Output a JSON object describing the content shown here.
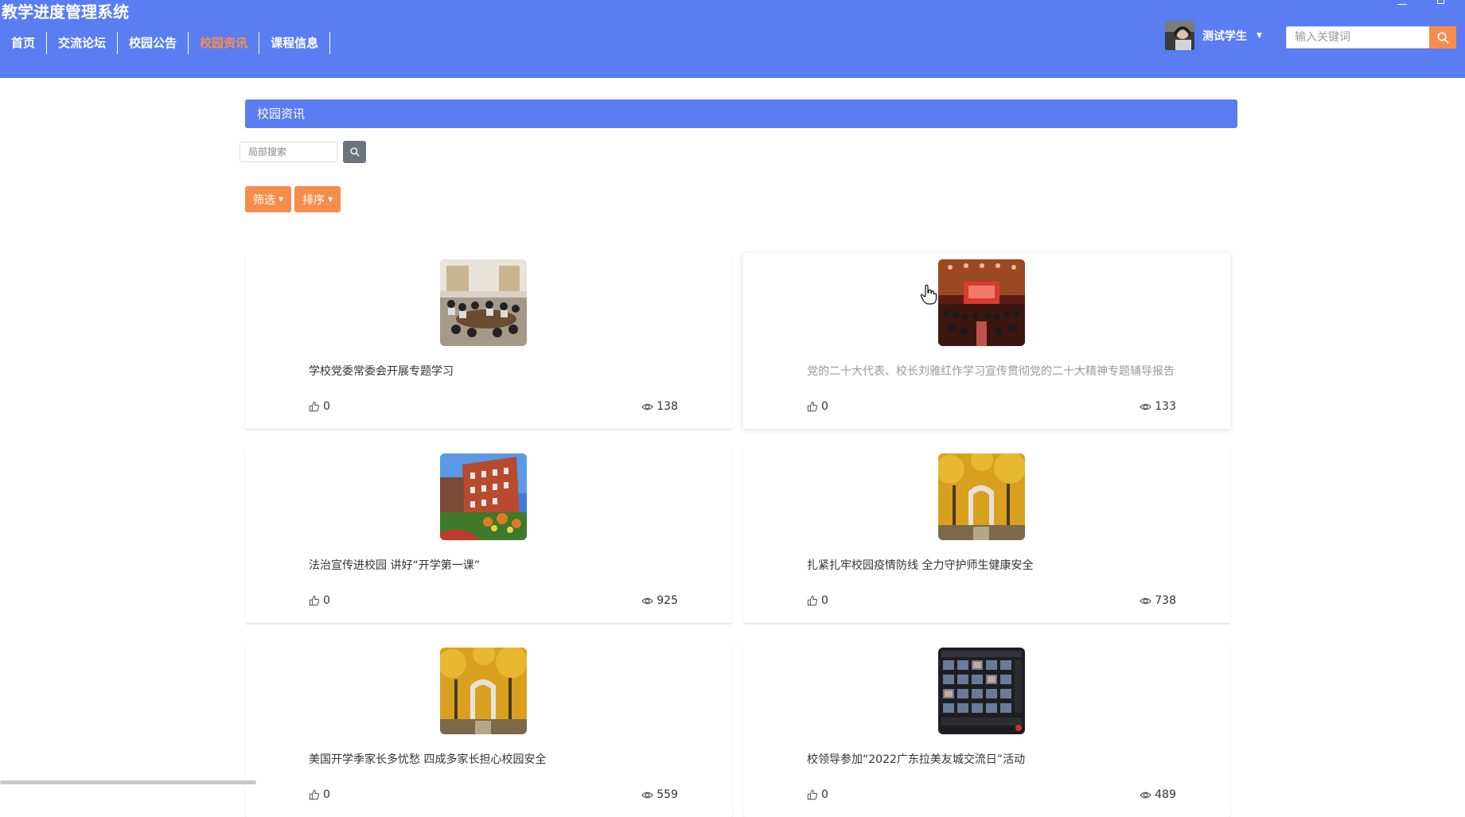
{
  "app": {
    "title": "教学进度管理系统"
  },
  "nav": {
    "items": [
      {
        "label": "首页"
      },
      {
        "label": "交流论坛"
      },
      {
        "label": "校园公告"
      },
      {
        "label": "校园资讯"
      },
      {
        "label": "课程信息"
      }
    ],
    "active": "校园资讯"
  },
  "user": {
    "name": "测试学生"
  },
  "header_search": {
    "placeholder": "输入关键词"
  },
  "section": {
    "title": "校园资讯"
  },
  "local_search": {
    "placeholder": "局部搜索"
  },
  "filters": {
    "filter_label": "筛选",
    "sort_label": "排序"
  },
  "colors": {
    "primary": "#5a7df2",
    "accent": "#f78d4c",
    "search_button": "#6c757d"
  },
  "news": [
    {
      "title": "学校党委常委会开展专题学习",
      "likes": "0",
      "views": "138",
      "image": "meeting-room-photo"
    },
    {
      "title": "党的二十大代表、校长刘雅红作学习宣传贯彻党的二十大精神专题辅导报告",
      "likes": "0",
      "views": "133",
      "image": "auditorium-photo"
    },
    {
      "title": "法治宣传进校园 讲好“开学第一课”",
      "likes": "0",
      "views": "925",
      "image": "campus-building-photo"
    },
    {
      "title": "扎紧扎牢校园疫情防线 全力守护师生健康安全",
      "likes": "0",
      "views": "738",
      "image": "autumn-gate-photo"
    },
    {
      "title": "美国开学季家长多忧愁 四成多家长担心校园安全",
      "likes": "0",
      "views": "559",
      "image": "autumn-gate-photo"
    },
    {
      "title": "校领导参加“2022广东拉美友城交流日”活动",
      "likes": "0",
      "views": "489",
      "image": "video-conference-photo"
    }
  ]
}
